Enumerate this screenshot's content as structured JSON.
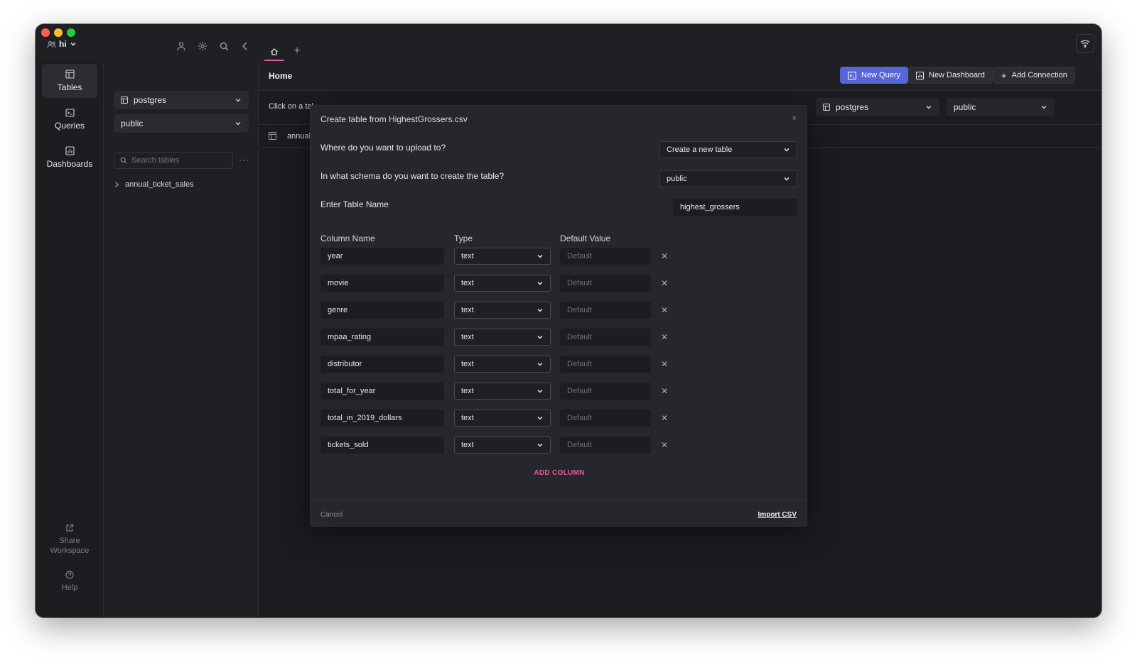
{
  "workspace": {
    "name": "hi"
  },
  "rail": {
    "items": [
      {
        "label": "Tables",
        "icon": "table-icon"
      },
      {
        "label": "Queries",
        "icon": "terminal-icon"
      },
      {
        "label": "Dashboards",
        "icon": "dashboard-icon"
      }
    ],
    "share_label": "Share Workspace",
    "help_label": "Help"
  },
  "sidebar": {
    "database": "postgres",
    "schema": "public",
    "search_placeholder": "Search tables",
    "tables": [
      "annual_ticket_sales"
    ]
  },
  "tabs": {
    "home_icon": "home-icon",
    "add_icon": "plus-icon"
  },
  "header": {
    "title": "Home",
    "new_query": "New Query",
    "new_dashboard": "New Dashboard",
    "add_connection": "Add Connection"
  },
  "subbar": {
    "hint": "Click on a tal",
    "database": "postgres",
    "schema": "public",
    "row_label": "annual"
  },
  "modal": {
    "title": "Create table from HighestGrossers.csv",
    "close": "×",
    "upload_question": "Where do you want to upload to?",
    "upload_value": "Create a new table",
    "schema_question": "In what schema do you want to create the table?",
    "schema_value": "public",
    "table_name_label": "Enter Table Name",
    "table_name_value": "highest_grossers",
    "headers": {
      "name": "Column Name",
      "type": "Type",
      "default": "Default Value"
    },
    "default_placeholder": "Default",
    "columns": [
      {
        "name": "year",
        "type": "text"
      },
      {
        "name": "movie",
        "type": "text"
      },
      {
        "name": "genre",
        "type": "text"
      },
      {
        "name": "mpaa_rating",
        "type": "text"
      },
      {
        "name": "distributor",
        "type": "text"
      },
      {
        "name": "total_for_year",
        "type": "text"
      },
      {
        "name": "total_in_2019_dollars",
        "type": "text"
      },
      {
        "name": "tickets_sold",
        "type": "text"
      }
    ],
    "add_column": "ADD COLUMN",
    "cancel": "Cancel",
    "import": "Import CSV"
  },
  "colors": {
    "accent": "#e35aa0",
    "primary_button": "#5865d6",
    "background": "#202125"
  }
}
